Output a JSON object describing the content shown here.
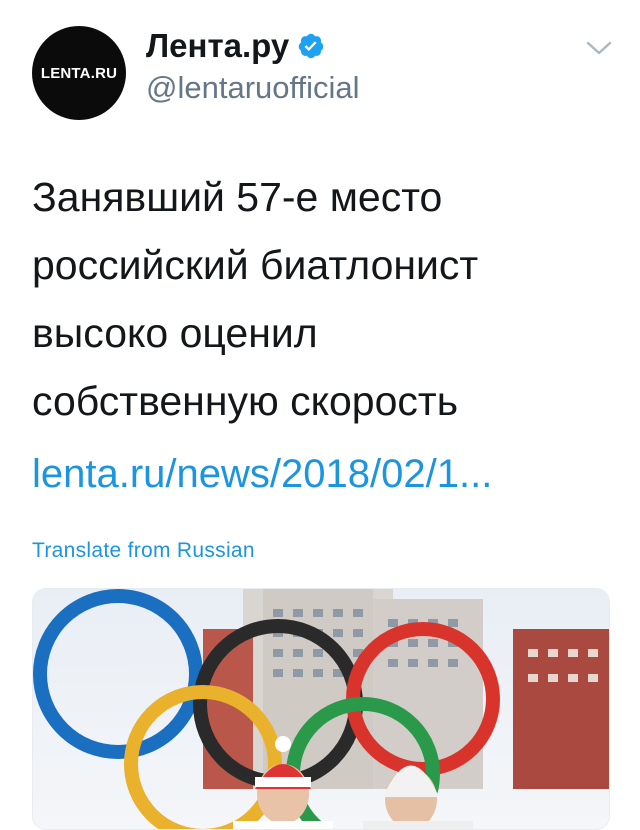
{
  "tweet": {
    "avatar_text": "LENTA.RU",
    "display_name": "Лента.ру",
    "verified_icon": "verified-badge-icon",
    "handle": "@lentaruofficial",
    "menu_icon": "chevron-down-icon",
    "text_lines": [
      "Занявший 57-е место",
      "российский биатлонист",
      "высоко оценил",
      "собственную скорость"
    ],
    "link": "lenta.ru/news/2018/02/1...",
    "translate_label": "Translate from Russian",
    "media_icon": "olympic-rings-photo"
  },
  "colors": {
    "accent": "#1b95e0",
    "text": "#14171a",
    "muted": "#657786",
    "avatar_bg": "#0b0b0b"
  }
}
